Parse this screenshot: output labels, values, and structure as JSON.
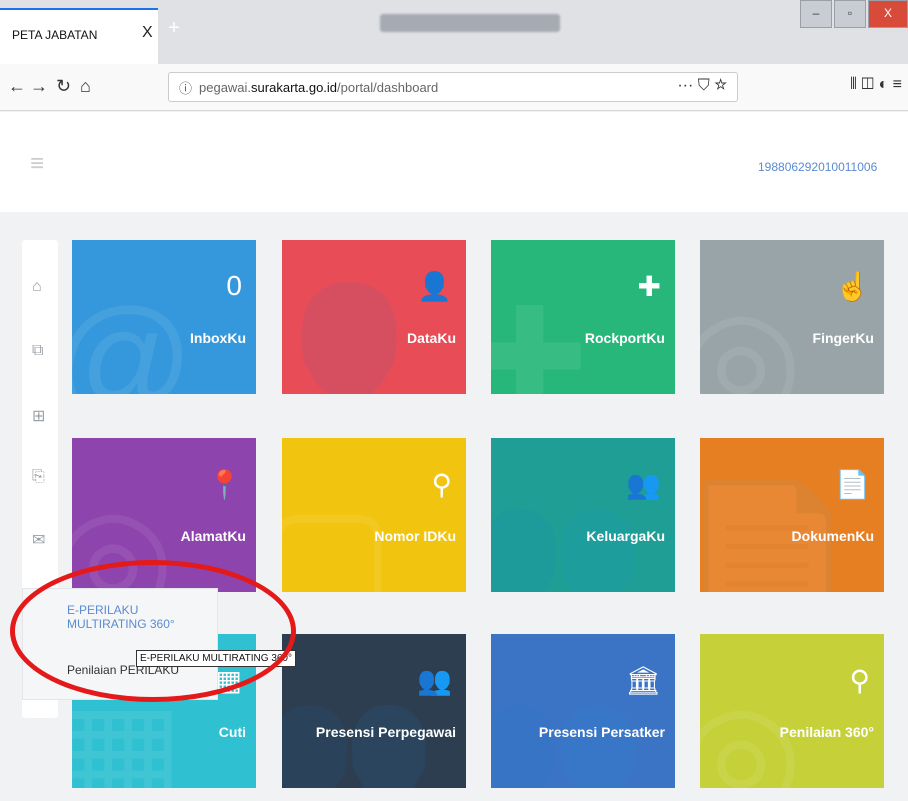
{
  "browser": {
    "tab_title": "PETA JABATAN",
    "tab_close": "X",
    "new_tab": "+",
    "url_info_icon": "ⓘ",
    "url_prefix": "pegawai.",
    "url_domain": "surakarta.go.id",
    "url_path": "/portal/dashboard",
    "url_actions": "··· ⛉ ☆",
    "toolbar_icons": "⫴ ◫ ◐ ≡",
    "window_min": "–",
    "window_max": "▫",
    "window_close": "X"
  },
  "header": {
    "menu_icon": "≡",
    "user_id": "198806292010011006"
  },
  "sidebar": {
    "icons": [
      "home-icon",
      "layers-icon",
      "medical-kit-icon",
      "documents-icon",
      "mail-icon",
      "database-icon",
      "document-icon"
    ]
  },
  "popup": {
    "items": [
      "E-PERILAKU MULTIRATING 360°",
      "Penilaian PERILAKU"
    ],
    "tooltip": "E-PERILAKU MULTIRATING 360°"
  },
  "tiles": [
    {
      "label": "InboxKu",
      "icon": "0",
      "bg_icon": "@",
      "color": "#3698dc"
    },
    {
      "label": "DataKu",
      "icon": "👤",
      "bg_icon": "👤",
      "color": "#e74c57"
    },
    {
      "label": "RockportKu",
      "icon": "✚",
      "bg_icon": "✚",
      "color": "#27b77a"
    },
    {
      "label": "FingerKu",
      "icon": "☝",
      "bg_icon": "◎",
      "color": "#98a4a8"
    },
    {
      "label": "AlamatKu",
      "icon": "📍",
      "bg_icon": "◎",
      "color": "#8e44ad"
    },
    {
      "label": "Nomor IDKu",
      "icon": "⚲",
      "bg_icon": "▢",
      "color": "#f1c40f"
    },
    {
      "label": "KeluargaKu",
      "icon": "👥",
      "bg_icon": "👥",
      "color": "#1e9e95"
    },
    {
      "label": "DokumenKu",
      "icon": "📄",
      "bg_icon": "📄",
      "color": "#e67e22"
    },
    {
      "label": "Cuti",
      "icon": "▦",
      "bg_icon": "▦",
      "color": "#2fc0d1"
    },
    {
      "label": "Presensi Perpegawai",
      "icon": "👥",
      "bg_icon": "👥",
      "color": "#2c3e50"
    },
    {
      "label": "Presensi Persatker",
      "icon": "🏛",
      "bg_icon": "👥",
      "color": "#3b74c4"
    },
    {
      "label": "Penilaian 360°",
      "icon": "⚲",
      "bg_icon": "◎",
      "color": "#c6d13a"
    }
  ]
}
